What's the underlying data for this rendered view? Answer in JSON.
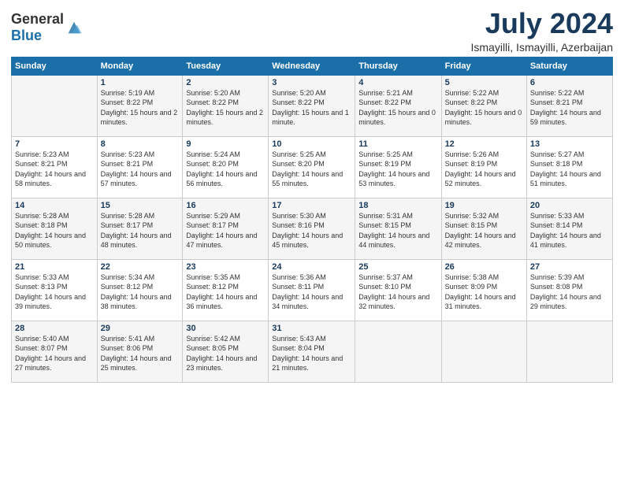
{
  "header": {
    "logo_general": "General",
    "logo_blue": "Blue",
    "month": "July 2024",
    "location": "Ismayilli, Ismayilli, Azerbaijan"
  },
  "weekdays": [
    "Sunday",
    "Monday",
    "Tuesday",
    "Wednesday",
    "Thursday",
    "Friday",
    "Saturday"
  ],
  "weeks": [
    [
      {
        "day": "",
        "sunrise": "",
        "sunset": "",
        "daylight": ""
      },
      {
        "day": "1",
        "sunrise": "Sunrise: 5:19 AM",
        "sunset": "Sunset: 8:22 PM",
        "daylight": "Daylight: 15 hours and 2 minutes."
      },
      {
        "day": "2",
        "sunrise": "Sunrise: 5:20 AM",
        "sunset": "Sunset: 8:22 PM",
        "daylight": "Daylight: 15 hours and 2 minutes."
      },
      {
        "day": "3",
        "sunrise": "Sunrise: 5:20 AM",
        "sunset": "Sunset: 8:22 PM",
        "daylight": "Daylight: 15 hours and 1 minute."
      },
      {
        "day": "4",
        "sunrise": "Sunrise: 5:21 AM",
        "sunset": "Sunset: 8:22 PM",
        "daylight": "Daylight: 15 hours and 0 minutes."
      },
      {
        "day": "5",
        "sunrise": "Sunrise: 5:22 AM",
        "sunset": "Sunset: 8:22 PM",
        "daylight": "Daylight: 15 hours and 0 minutes."
      },
      {
        "day": "6",
        "sunrise": "Sunrise: 5:22 AM",
        "sunset": "Sunset: 8:21 PM",
        "daylight": "Daylight: 14 hours and 59 minutes."
      }
    ],
    [
      {
        "day": "7",
        "sunrise": "Sunrise: 5:23 AM",
        "sunset": "Sunset: 8:21 PM",
        "daylight": "Daylight: 14 hours and 58 minutes."
      },
      {
        "day": "8",
        "sunrise": "Sunrise: 5:23 AM",
        "sunset": "Sunset: 8:21 PM",
        "daylight": "Daylight: 14 hours and 57 minutes."
      },
      {
        "day": "9",
        "sunrise": "Sunrise: 5:24 AM",
        "sunset": "Sunset: 8:20 PM",
        "daylight": "Daylight: 14 hours and 56 minutes."
      },
      {
        "day": "10",
        "sunrise": "Sunrise: 5:25 AM",
        "sunset": "Sunset: 8:20 PM",
        "daylight": "Daylight: 14 hours and 55 minutes."
      },
      {
        "day": "11",
        "sunrise": "Sunrise: 5:25 AM",
        "sunset": "Sunset: 8:19 PM",
        "daylight": "Daylight: 14 hours and 53 minutes."
      },
      {
        "day": "12",
        "sunrise": "Sunrise: 5:26 AM",
        "sunset": "Sunset: 8:19 PM",
        "daylight": "Daylight: 14 hours and 52 minutes."
      },
      {
        "day": "13",
        "sunrise": "Sunrise: 5:27 AM",
        "sunset": "Sunset: 8:18 PM",
        "daylight": "Daylight: 14 hours and 51 minutes."
      }
    ],
    [
      {
        "day": "14",
        "sunrise": "Sunrise: 5:28 AM",
        "sunset": "Sunset: 8:18 PM",
        "daylight": "Daylight: 14 hours and 50 minutes."
      },
      {
        "day": "15",
        "sunrise": "Sunrise: 5:28 AM",
        "sunset": "Sunset: 8:17 PM",
        "daylight": "Daylight: 14 hours and 48 minutes."
      },
      {
        "day": "16",
        "sunrise": "Sunrise: 5:29 AM",
        "sunset": "Sunset: 8:17 PM",
        "daylight": "Daylight: 14 hours and 47 minutes."
      },
      {
        "day": "17",
        "sunrise": "Sunrise: 5:30 AM",
        "sunset": "Sunset: 8:16 PM",
        "daylight": "Daylight: 14 hours and 45 minutes."
      },
      {
        "day": "18",
        "sunrise": "Sunrise: 5:31 AM",
        "sunset": "Sunset: 8:15 PM",
        "daylight": "Daylight: 14 hours and 44 minutes."
      },
      {
        "day": "19",
        "sunrise": "Sunrise: 5:32 AM",
        "sunset": "Sunset: 8:15 PM",
        "daylight": "Daylight: 14 hours and 42 minutes."
      },
      {
        "day": "20",
        "sunrise": "Sunrise: 5:33 AM",
        "sunset": "Sunset: 8:14 PM",
        "daylight": "Daylight: 14 hours and 41 minutes."
      }
    ],
    [
      {
        "day": "21",
        "sunrise": "Sunrise: 5:33 AM",
        "sunset": "Sunset: 8:13 PM",
        "daylight": "Daylight: 14 hours and 39 minutes."
      },
      {
        "day": "22",
        "sunrise": "Sunrise: 5:34 AM",
        "sunset": "Sunset: 8:12 PM",
        "daylight": "Daylight: 14 hours and 38 minutes."
      },
      {
        "day": "23",
        "sunrise": "Sunrise: 5:35 AM",
        "sunset": "Sunset: 8:12 PM",
        "daylight": "Daylight: 14 hours and 36 minutes."
      },
      {
        "day": "24",
        "sunrise": "Sunrise: 5:36 AM",
        "sunset": "Sunset: 8:11 PM",
        "daylight": "Daylight: 14 hours and 34 minutes."
      },
      {
        "day": "25",
        "sunrise": "Sunrise: 5:37 AM",
        "sunset": "Sunset: 8:10 PM",
        "daylight": "Daylight: 14 hours and 32 minutes."
      },
      {
        "day": "26",
        "sunrise": "Sunrise: 5:38 AM",
        "sunset": "Sunset: 8:09 PM",
        "daylight": "Daylight: 14 hours and 31 minutes."
      },
      {
        "day": "27",
        "sunrise": "Sunrise: 5:39 AM",
        "sunset": "Sunset: 8:08 PM",
        "daylight": "Daylight: 14 hours and 29 minutes."
      }
    ],
    [
      {
        "day": "28",
        "sunrise": "Sunrise: 5:40 AM",
        "sunset": "Sunset: 8:07 PM",
        "daylight": "Daylight: 14 hours and 27 minutes."
      },
      {
        "day": "29",
        "sunrise": "Sunrise: 5:41 AM",
        "sunset": "Sunset: 8:06 PM",
        "daylight": "Daylight: 14 hours and 25 minutes."
      },
      {
        "day": "30",
        "sunrise": "Sunrise: 5:42 AM",
        "sunset": "Sunset: 8:05 PM",
        "daylight": "Daylight: 14 hours and 23 minutes."
      },
      {
        "day": "31",
        "sunrise": "Sunrise: 5:43 AM",
        "sunset": "Sunset: 8:04 PM",
        "daylight": "Daylight: 14 hours and 21 minutes."
      },
      {
        "day": "",
        "sunrise": "",
        "sunset": "",
        "daylight": ""
      },
      {
        "day": "",
        "sunrise": "",
        "sunset": "",
        "daylight": ""
      },
      {
        "day": "",
        "sunrise": "",
        "sunset": "",
        "daylight": ""
      }
    ]
  ]
}
